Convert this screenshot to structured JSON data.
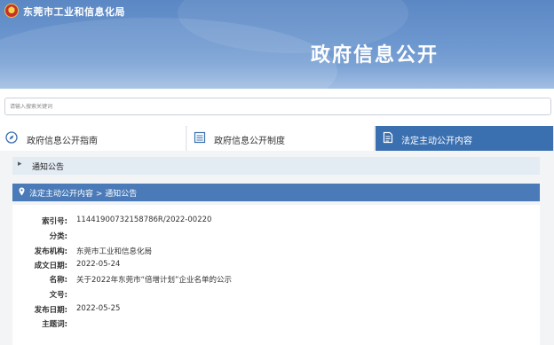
{
  "header": {
    "site_title": "东莞市工业和信息化局",
    "banner_title": "政府信息公开"
  },
  "search": {
    "placeholder": "请输入搜索关键词"
  },
  "tabs": [
    {
      "label": "政府信息公开指南",
      "icon": "compass-icon",
      "active": false
    },
    {
      "label": "政府信息公开制度",
      "icon": "document-list-icon",
      "active": false
    },
    {
      "label": "法定主动公开内容",
      "icon": "document-icon",
      "active": true
    }
  ],
  "notice": {
    "label": "通知公告"
  },
  "breadcrumb": {
    "text": "法定主动公开内容 > 通知公告"
  },
  "details": [
    {
      "label": "索引号:",
      "value": "11441900732158786R/2022-00220"
    },
    {
      "label": "分类:",
      "value": ""
    },
    {
      "label": "发布机构:",
      "value": "东莞市工业和信息化局"
    },
    {
      "label": "成文日期:",
      "value": "2022-05-24"
    },
    {
      "label": "名称:",
      "value": "关于2022年东莞市“倍增计划”企业名单的公示"
    },
    {
      "label": "文号:",
      "value": ""
    },
    {
      "label": "发布日期:",
      "value": "2022-05-25"
    },
    {
      "label": "主题词:",
      "value": ""
    }
  ],
  "colors": {
    "banner": "#6f99d0",
    "active_tab": "#3a6fb0",
    "breadcrumb_bar": "#4a7ab8",
    "notice_bar": "#e3ebf3"
  }
}
